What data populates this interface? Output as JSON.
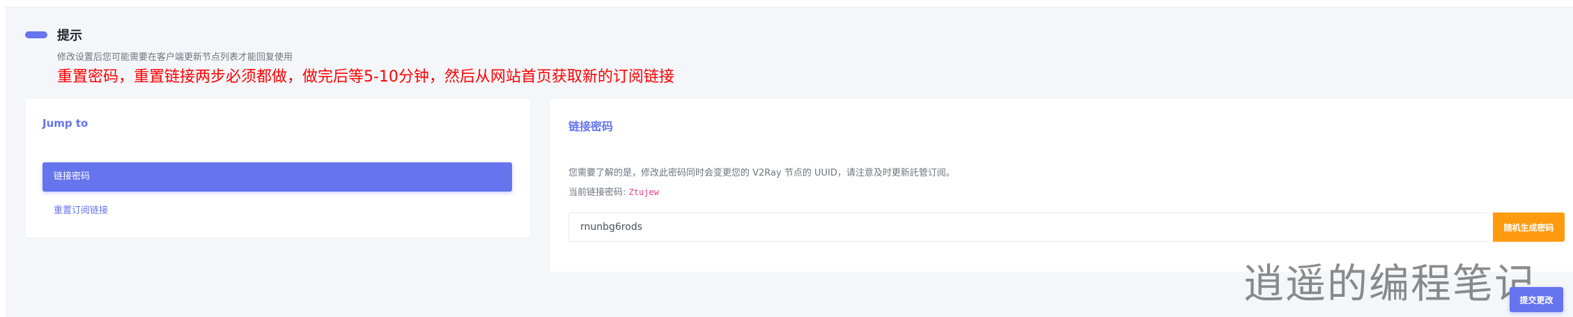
{
  "notice": {
    "title": "提示",
    "subtitle": "修改设置后您可能需要在客户端更新节点列表才能回复使用",
    "warning": "重置密码，重置链接两步必须都做，做完后等5-10分钟，然后从网站首页获取新的订阅链接"
  },
  "jump": {
    "title": "Jump to",
    "items": [
      {
        "label": "链接密码",
        "active": true
      },
      {
        "label": "重置订阅链接",
        "active": false
      }
    ]
  },
  "password": {
    "title": "链接密码",
    "description": "您需要了解的是，修改此密码同时会变更您的 V2Ray 节点的 UUID，请注意及时更新託管订阅。",
    "current_label": "当前链接密码: ",
    "current_value": "Ztujew",
    "input_value": "rnunbg6rods",
    "generate_label": "随机生成密码",
    "submit_label": "提交更改"
  },
  "watermark": "逍遥的编程笔记",
  "colors": {
    "primary": "#6674ee",
    "warning_text": "#ff0000",
    "generate_button": "#ff9b0f",
    "code": "#e83e8c"
  }
}
